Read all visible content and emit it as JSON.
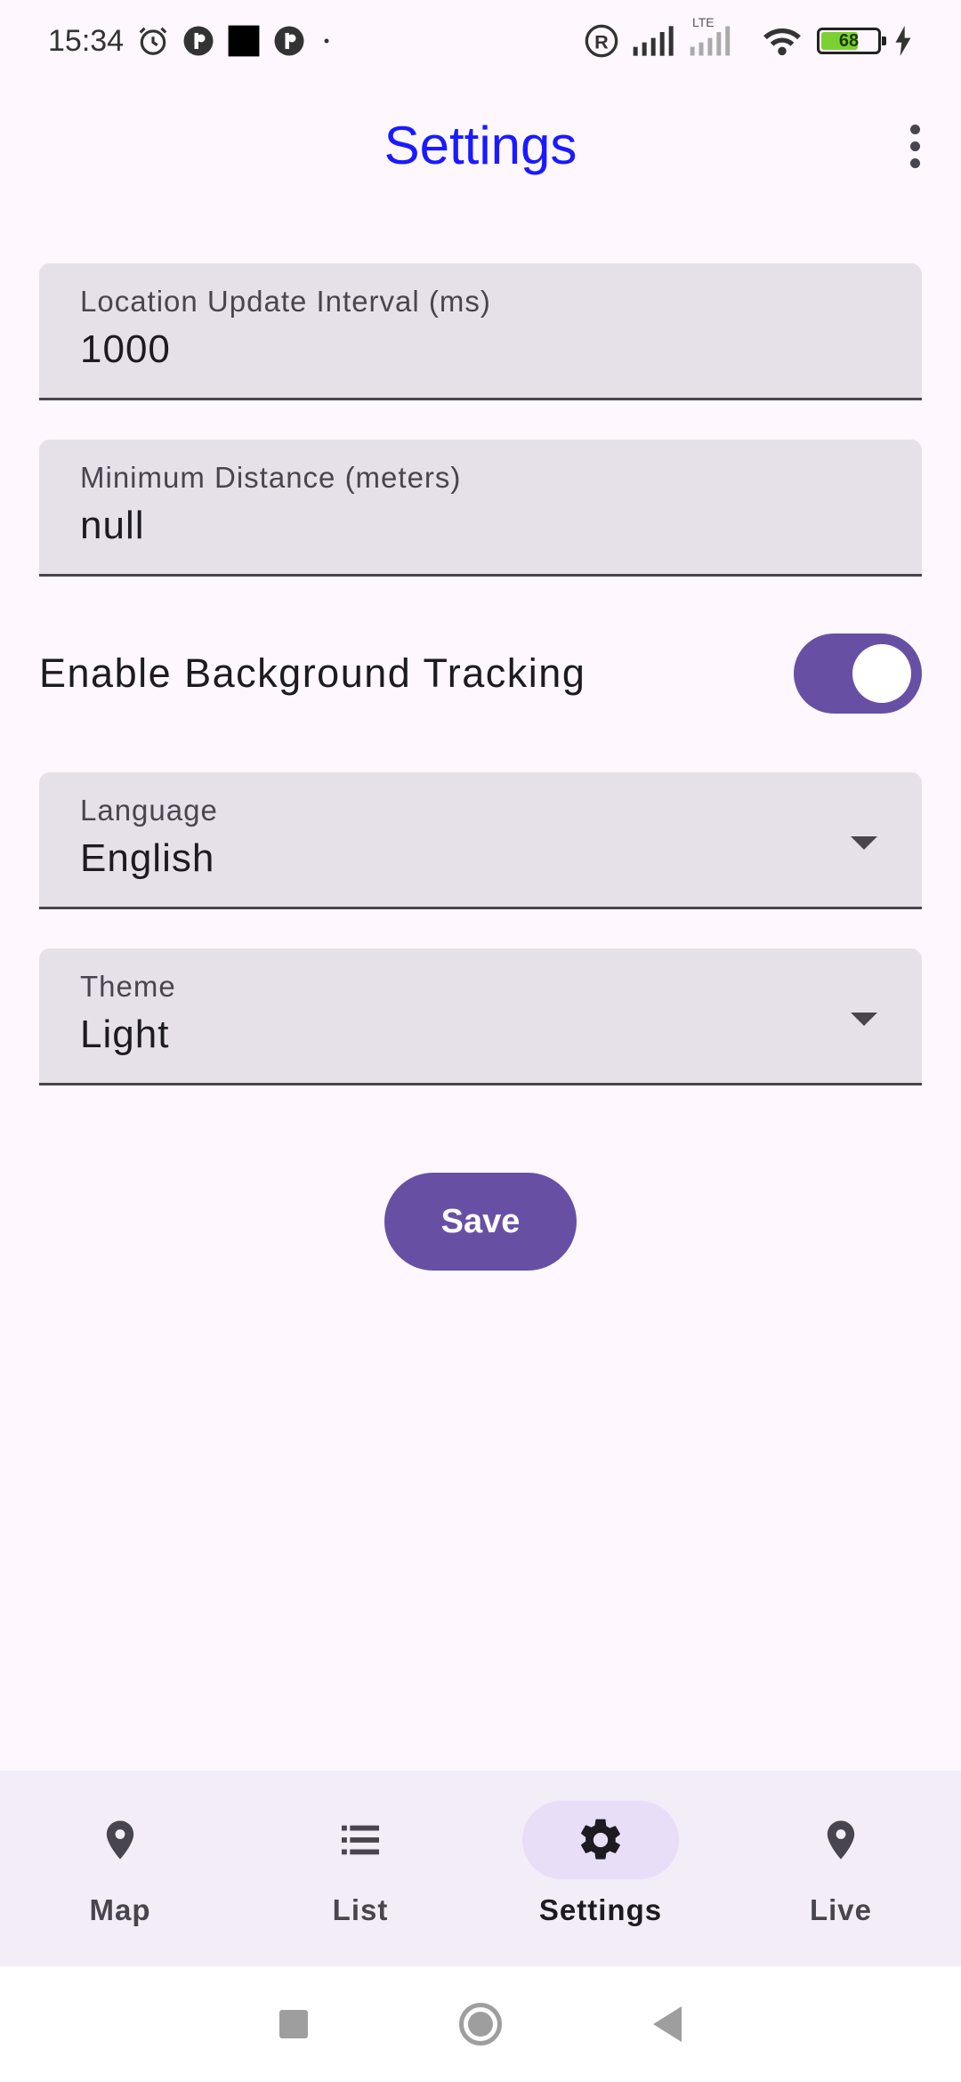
{
  "status_bar": {
    "time": "15:34",
    "battery": "68",
    "battery_level": 0.68,
    "network": "LTE",
    "icons": [
      "alarm-icon",
      "app-notification-icon",
      "black-square-icon",
      "app-notification-icon",
      "dot-icon",
      "registered-icon",
      "signal-icon",
      "lte-signal-icon",
      "wifi-icon",
      "battery-icon",
      "charging-icon"
    ]
  },
  "app_bar": {
    "title": "Settings",
    "menu_icon": "more-vert-icon"
  },
  "form": {
    "interval": {
      "label": "Location Update Interval (ms)",
      "value": "1000"
    },
    "distance": {
      "label": "Minimum Distance (meters)",
      "value": "null"
    },
    "background_tracking": {
      "label": "Enable Background Tracking",
      "enabled": true
    },
    "language": {
      "label": "Language",
      "value": "English"
    },
    "theme": {
      "label": "Theme",
      "value": "Light"
    },
    "save_label": "Save"
  },
  "bottom_nav": {
    "items": [
      {
        "label": "Map",
        "icon": "location-pin-icon",
        "active": false
      },
      {
        "label": "List",
        "icon": "list-icon",
        "active": false
      },
      {
        "label": "Settings",
        "icon": "gear-icon",
        "active": true
      },
      {
        "label": "Live",
        "icon": "location-pin-icon",
        "active": false
      }
    ]
  },
  "colors": {
    "primary": "#6750a4",
    "title": "#1a1aff",
    "field_bg": "#e6e0e9",
    "nav_bg": "#f3edf7",
    "active_indicator": "#e8def8"
  }
}
